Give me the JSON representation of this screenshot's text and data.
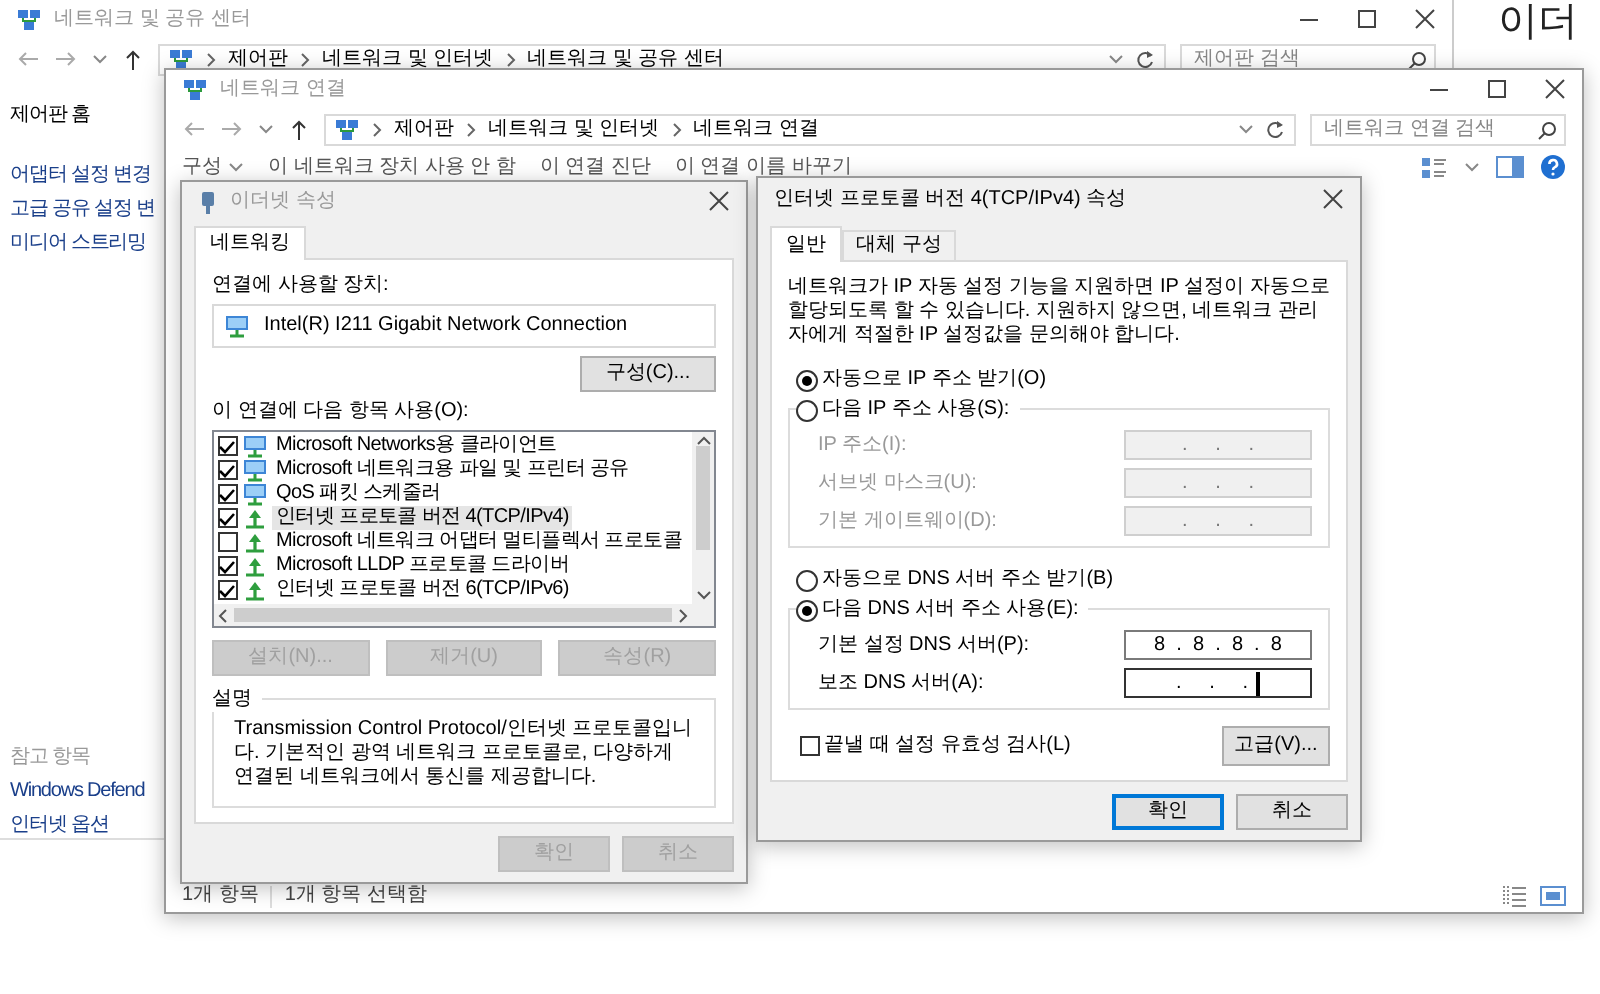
{
  "sharing_center": {
    "title": "네트워크 및 공유 센터",
    "breadcrumb": [
      "제어판",
      "네트워크 및 인터넷",
      "네트워크 및 공유 센터"
    ],
    "search_placeholder": "제어판 검색",
    "sidebar_home": "제어판 홈",
    "sidebar_links": [
      "어댑터 설정 변경",
      "고급 공유 설정 변",
      "미디어 스트리밍"
    ],
    "see_also_title": "참고 항목",
    "see_also_links": [
      "Windows Defend",
      "인터넷 옵션"
    ]
  },
  "ethernet_window": {
    "heading": "이더"
  },
  "network_connections": {
    "title": "네트워크 연결",
    "breadcrumb": [
      "제어판",
      "네트워크 및 인터넷",
      "네트워크 연결"
    ],
    "search_placeholder": "네트워크 연결 검색",
    "toolbar": [
      "구성",
      "이 네트워크 장치 사용 안 함",
      "이 연결 진단",
      "이 연결 이름 바꾸기"
    ],
    "status_bar": [
      "1개 항목",
      "1개 항목 선택함"
    ]
  },
  "ethernet_properties": {
    "title": "이더넷 속성",
    "tabs": [
      {
        "label": "네트워킹",
        "selected": true
      }
    ],
    "device_label": "연결에 사용할 장치:",
    "device": "Intel(R) I211 Gigabit Network Connection",
    "configure_button": "구성(C)...",
    "items_label": "이 연결에 다음 항목 사용(O):",
    "items": [
      {
        "label": "Microsoft Networks용 클라이언트",
        "kind": "component",
        "checked": true,
        "selected": false
      },
      {
        "label": "Microsoft 네트워크용 파일 및 프린터 공유",
        "kind": "component",
        "checked": true,
        "selected": false
      },
      {
        "label": "QoS 패킷 스케줄러",
        "kind": "component",
        "checked": true,
        "selected": false
      },
      {
        "label": "인터넷 프로토콜 버전 4(TCP/IPv4)",
        "kind": "protocol",
        "checked": true,
        "selected": true
      },
      {
        "label": "Microsoft 네트워크 어댑터 멀티플렉서 프로토콜",
        "kind": "protocol",
        "checked": false,
        "selected": false
      },
      {
        "label": "Microsoft LLDP 프로토콜 드라이버",
        "kind": "protocol",
        "checked": true,
        "selected": false
      },
      {
        "label": "인터넷 프로토콜 버전 6(TCP/IPv6)",
        "kind": "protocol",
        "checked": true,
        "selected": false
      }
    ],
    "item_buttons": [
      {
        "label": "설치(N)...",
        "disabled": true
      },
      {
        "label": "제거(U)",
        "disabled": true
      },
      {
        "label": "속성(R)",
        "disabled": true
      }
    ],
    "description_title": "설명",
    "description": "Transmission Control Protocol/인터넷 프로토콜입니다. 기본적인 광역 네트워크 프로토콜로, 다양하게 연결된 네트워크에서 통신를 제공합니다.",
    "buttons": [
      {
        "label": "확인",
        "disabled": true
      },
      {
        "label": "취소",
        "disabled": true
      }
    ]
  },
  "ipv4_properties": {
    "title": "인터넷 프로토콜 버전 4(TCP/IPv4) 속성",
    "tabs": [
      {
        "label": "일반",
        "selected": true
      },
      {
        "label": "대체 구성",
        "selected": false
      }
    ],
    "intro": "네트워크가 IP 자동 설정 기능을 지원하면 IP 설정이 자동으로 할당되도록 할 수 있습니다. 지원하지 않으면, 네트워크 관리자에게 적절한 IP 설정값을 문의해야 합니다.",
    "ip_options": [
      {
        "label": "자동으로 IP 주소 받기(O)",
        "selected": true
      },
      {
        "label": "다음 IP 주소 사용(S):",
        "selected": false
      }
    ],
    "ip_fields": [
      {
        "label": "IP 주소(I):",
        "value": ".     .     .",
        "disabled": true,
        "focused": false
      },
      {
        "label": "서브넷 마스크(U):",
        "value": ".     .     .",
        "disabled": true,
        "focused": false
      },
      {
        "label": "기본 게이트웨이(D):",
        "value": ".     .     .",
        "disabled": true,
        "focused": false
      }
    ],
    "dns_options": [
      {
        "label": "자동으로 DNS 서버 주소 받기(B)",
        "selected": false
      },
      {
        "label": "다음 DNS 서버 주소 사용(E):",
        "selected": true
      }
    ],
    "dns_fields": [
      {
        "label": "기본 설정 DNS 서버(P):",
        "value": "8  .  8  .  8  .  8",
        "disabled": false,
        "focused": false
      },
      {
        "label": "보조 DNS 서버(A):",
        "value": ".     .     .",
        "disabled": false,
        "focused": true
      }
    ],
    "validate": {
      "label": "끝낼 때 설정 유효성 검사(L)",
      "checked": false
    },
    "advanced_button": "고급(V)...",
    "buttons": [
      {
        "label": "확인",
        "default": true
      },
      {
        "label": "취소",
        "default": false
      }
    ]
  }
}
